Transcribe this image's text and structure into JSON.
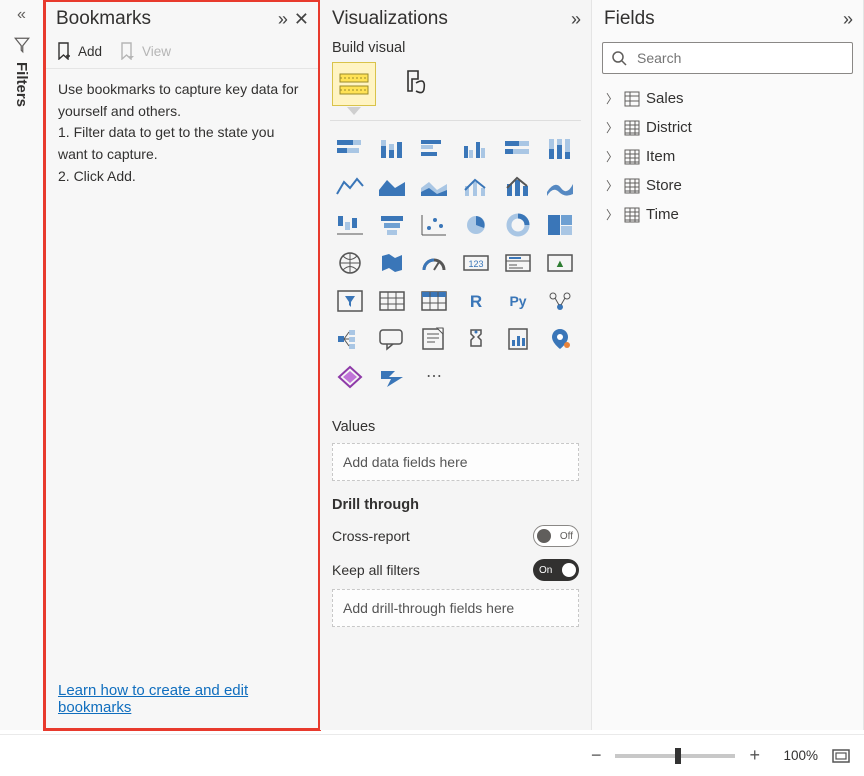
{
  "filters_rail": {
    "label": "Filters"
  },
  "bookmarks": {
    "title": "Bookmarks",
    "add_label": "Add",
    "view_label": "View",
    "help_intro": "Use bookmarks to capture key data for yourself and others.",
    "help_step1": "1. Filter data to get to the state you want to capture.",
    "help_step2": "2. Click Add.",
    "learn_link": "Learn how to create and edit bookmarks"
  },
  "viz": {
    "title": "Visualizations",
    "subtitle": "Build visual",
    "values_label": "Values",
    "values_placeholder": "Add data fields here",
    "drill_label": "Drill through",
    "cross_report_label": "Cross-report",
    "cross_report_state": "Off",
    "keep_filters_label": "Keep all filters",
    "keep_filters_state": "On",
    "drill_placeholder": "Add drill-through fields here",
    "items": [
      "stacked-bar",
      "stacked-column",
      "clustered-bar",
      "clustered-column",
      "stacked-bar-100",
      "stacked-column-100",
      "line",
      "area",
      "stacked-area",
      "line-clustered",
      "line-stacked",
      "ribbon",
      "waterfall",
      "funnel",
      "scatter",
      "pie",
      "donut",
      "treemap",
      "map",
      "filled-map",
      "gauge",
      "card",
      "multi-card",
      "kpi",
      "slicer",
      "table",
      "matrix",
      "r-visual",
      "py-visual",
      "key-influencers",
      "decomposition",
      "qna",
      "narrative",
      "goals",
      "paginated",
      "arcgis",
      "powerapps",
      "automate",
      "more"
    ],
    "glyphs": {
      "r-visual": "R",
      "py-visual": "Py",
      "card": "123",
      "kpi": "▲",
      "more": "⋯"
    }
  },
  "fields": {
    "title": "Fields",
    "search_placeholder": "Search",
    "tables": [
      {
        "name": "Sales",
        "icon": "sum"
      },
      {
        "name": "District",
        "icon": "table"
      },
      {
        "name": "Item",
        "icon": "table"
      },
      {
        "name": "Store",
        "icon": "table"
      },
      {
        "name": "Time",
        "icon": "table"
      }
    ]
  },
  "footer": {
    "zoom": "100%"
  }
}
